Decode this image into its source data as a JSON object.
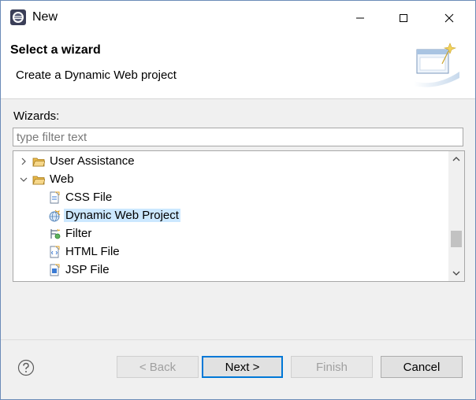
{
  "window": {
    "title": "New"
  },
  "header": {
    "title": "Select a wizard",
    "subtitle": "Create a Dynamic Web project"
  },
  "wizards": {
    "label": "Wizards:",
    "filter_placeholder": "type filter text",
    "tree": [
      {
        "label": "User Assistance",
        "icon": "folder-icon",
        "expanded": false
      },
      {
        "label": "Web",
        "icon": "folder-icon",
        "expanded": true
      },
      {
        "label": "CSS File",
        "icon": "css-file-icon"
      },
      {
        "label": "Dynamic Web Project",
        "icon": "dynamic-web-project-icon",
        "selected": true
      },
      {
        "label": "Filter",
        "icon": "filter-icon"
      },
      {
        "label": "HTML File",
        "icon": "html-file-icon"
      },
      {
        "label": "JSP File",
        "icon": "jsp-file-icon"
      }
    ]
  },
  "buttons": {
    "back": "< Back",
    "next": "Next >",
    "finish": "Finish",
    "cancel": "Cancel"
  },
  "colors": {
    "selection": "#cce8ff",
    "default_button_border": "#0078d7",
    "folder": "#e9b949"
  }
}
